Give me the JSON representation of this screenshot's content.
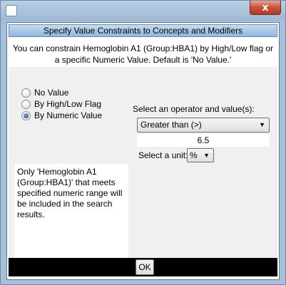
{
  "window": {
    "close_glyph": "x"
  },
  "dialog": {
    "title": "Specify Value Constraints to Concepts and Modifiers",
    "description_line1": "You can constrain Hemoglobin A1 (Group:HBA1) by High/Low flag or",
    "description_line2": "a specific Numeric Value. Default is 'No Value.'"
  },
  "constraint_options": [
    {
      "label": "No Value",
      "checked": false
    },
    {
      "label": "By High/Low Flag",
      "checked": false
    },
    {
      "label": "By Numeric Value",
      "checked": true
    }
  ],
  "info_text": "Only 'Hemoglobin A1 (Group:HBA1)' that meets specified numeric range will be included in the search results.",
  "operator": {
    "label": "Select an operator and value(s):",
    "selected": "Greater than (>)",
    "value": "6.5"
  },
  "unit": {
    "label": "Select a unit:",
    "selected": "%"
  },
  "footer": {
    "ok_label": "OK"
  },
  "icons": {
    "app": "app-window-icon",
    "close": "close-icon",
    "dropdown": "chevron-down-icon"
  }
}
